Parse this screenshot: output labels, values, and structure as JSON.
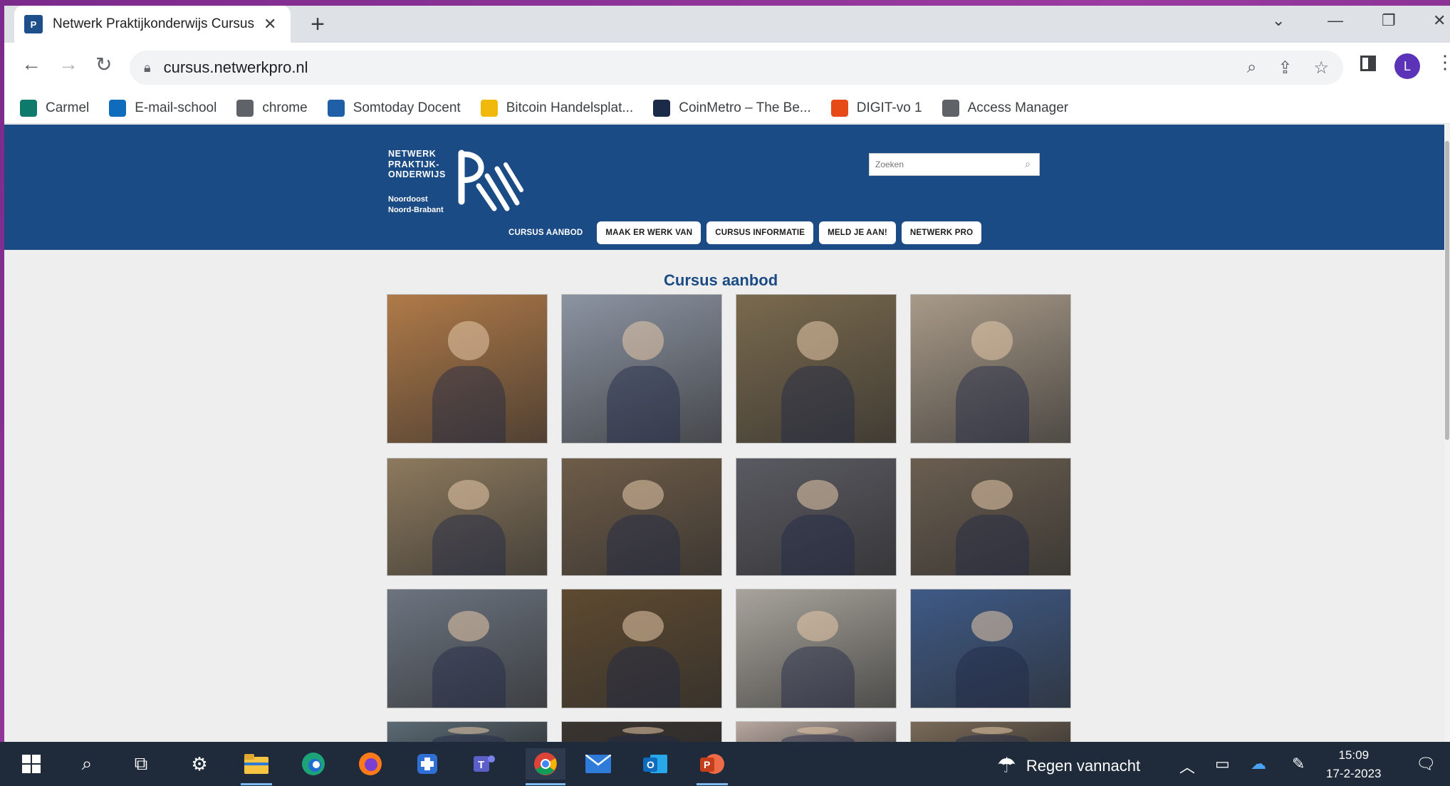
{
  "browser": {
    "tab_title": "Netwerk Praktijkonderwijs Cursus",
    "url": "cursus.netwerkpro.nl",
    "profile_initial": "L",
    "bookmarks": [
      {
        "label": "Carmel",
        "icon": "sharepoint-icon",
        "color": "#0e7a6b"
      },
      {
        "label": "E-mail-school",
        "icon": "outlook-icon",
        "color": "#0f6cbd"
      },
      {
        "label": "chrome",
        "icon": "globe-icon",
        "color": "#5f6368"
      },
      {
        "label": "Somtoday Docent",
        "icon": "somtoday-icon",
        "color": "#1f5fa8"
      },
      {
        "label": "Bitcoin Handelsplat...",
        "icon": "binance-icon",
        "color": "#f0b90b"
      },
      {
        "label": "CoinMetro – The Be...",
        "icon": "coinmetro-icon",
        "color": "#1c2a4a"
      },
      {
        "label": "DIGIT-vo 1",
        "icon": "cube-icon",
        "color": "#e64a19"
      },
      {
        "label": "Access Manager",
        "icon": "globe-icon",
        "color": "#5f6368"
      }
    ]
  },
  "site": {
    "logo_lines": [
      "NETWERK",
      "PRAKTIJK-",
      "ONDERWIJS"
    ],
    "logo_sub_lines": [
      "Noordoost",
      "Noord-Brabant"
    ],
    "search_placeholder": "Zoeken",
    "nav": [
      {
        "label": "CURSUS AANBOD",
        "style": "plain"
      },
      {
        "label": "MAAK ER WERK VAN",
        "style": "btn"
      },
      {
        "label": "CURSUS INFORMATIE",
        "style": "btn"
      },
      {
        "label": "MELD JE AAN!",
        "style": "btn"
      },
      {
        "label": "NETWERK PRO",
        "style": "btn"
      }
    ],
    "section_title": "Cursus aanbod",
    "courses": [
      {
        "photo": "student-measuring-wood-photo",
        "bg": "#b07a48"
      },
      {
        "photo": "students-reading-papers-photo",
        "bg": "#8c94a2"
      },
      {
        "photo": "forestry-chainsaw-photo",
        "bg": "#7a6a4e"
      },
      {
        "photo": "cooking-students-photo",
        "bg": "#a89a88"
      },
      {
        "photo": "sanding-woodwork-photo",
        "bg": "#8d7a5e"
      },
      {
        "photo": "warehouse-boxes-photo",
        "bg": "#6e5c48"
      },
      {
        "photo": "welding-photo",
        "bg": "#5a5a62"
      },
      {
        "photo": "engine-repair-photo",
        "bg": "#6a5e50"
      },
      {
        "photo": "forklift-photo",
        "bg": "#6c7480"
      },
      {
        "photo": "supermarket-apples-photo",
        "bg": "#5e4a30"
      },
      {
        "photo": "plastering-wall-photo",
        "bg": "#a8a49c"
      },
      {
        "photo": "metalwork-workshop-photo",
        "bg": "#3e5a86"
      },
      {
        "photo": "row4-photo-1",
        "bg": "#5a6a74"
      },
      {
        "photo": "row4-photo-2",
        "bg": "#3a3430"
      },
      {
        "photo": "row4-photo-3",
        "bg": "#b8a8a0"
      },
      {
        "photo": "row4-photo-4",
        "bg": "#7a6a58"
      }
    ]
  },
  "taskbar": {
    "weather_text": "Regen vannacht",
    "time": "15:09",
    "date": "17-2-2023"
  }
}
